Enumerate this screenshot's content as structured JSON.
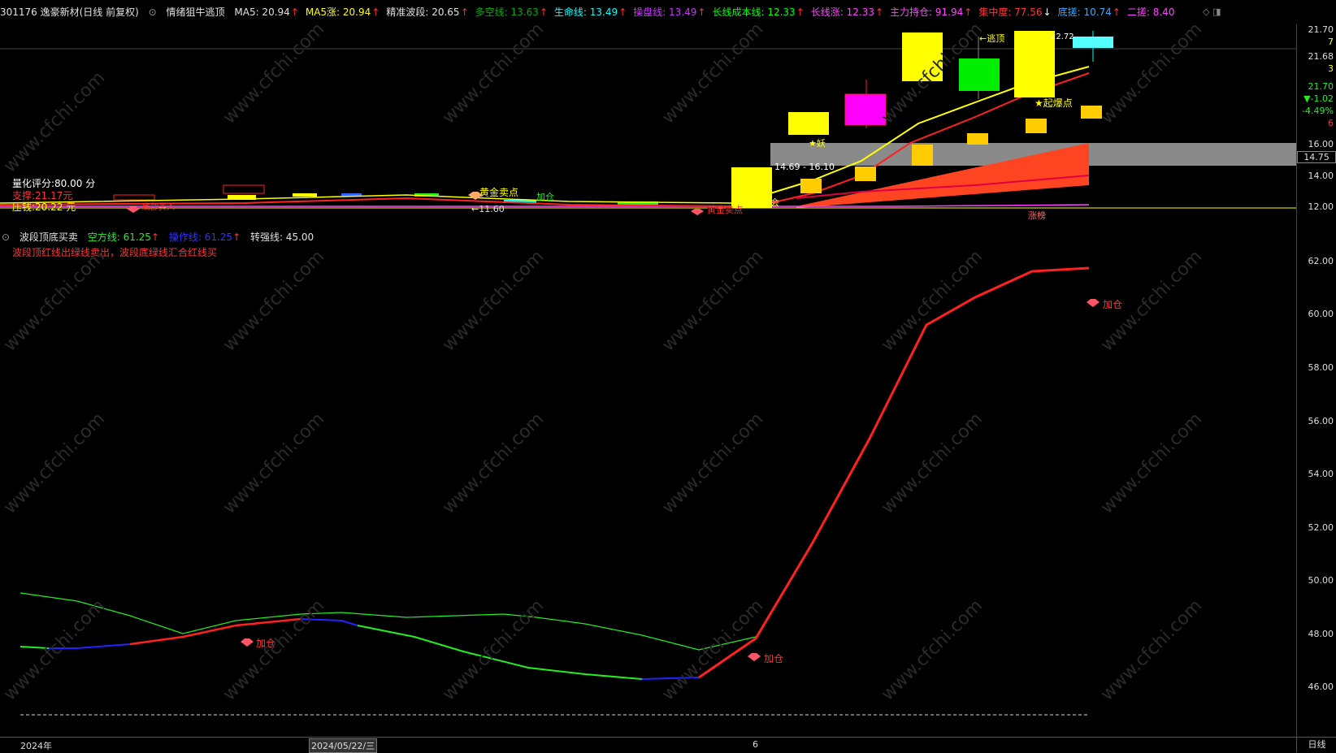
{
  "stock_header": {
    "code_name": "301176 逸豪新材(日线 前复权)",
    "indicator_name": "情绪狙牛逃顶",
    "items": [
      {
        "label": "MA5: 20.94",
        "color": "#e0e0e0",
        "arrow": "↑"
      },
      {
        "label": "MA5涨: 20.94",
        "color": "#ffff00",
        "arrow": "↑"
      },
      {
        "label": "精准波段: 20.65",
        "color": "#e0e0e0",
        "arrow": "↑"
      },
      {
        "label": "多空线: 13.63",
        "color": "#00aa00",
        "arrow": "↑"
      },
      {
        "label": "生命线: 13.49",
        "color": "#00ffff",
        "arrow": "↑"
      },
      {
        "label": "操盘线: 13.49",
        "color": "#cc33ff",
        "arrow": "↑"
      },
      {
        "label": "长线成本线: 12.33",
        "color": "#00ff00",
        "arrow": "↑"
      },
      {
        "label": "长线涨: 12.33",
        "color": "#ff44ff",
        "arrow": "↑"
      },
      {
        "label": "主力持仓: 91.94",
        "color": "#ff44ff",
        "arrow": "↑"
      },
      {
        "label": "集中度: 77.56",
        "color": "#ff3333",
        "arrow": "↓"
      },
      {
        "label": "底搓: 10.74",
        "color": "#33aaff",
        "arrow": "↑"
      },
      {
        "label": "二搓: 8.40",
        "color": "#ff44ff",
        "arrow": ""
      }
    ]
  },
  "price_panel": {
    "quant_score": "量化评分:80.00 分",
    "support": "支撑:21.17元",
    "pressure": "压钱:20.22 元",
    "range_label": "14.69 - 16.10",
    "low_mark": "←11.60",
    "high_mark": "←逃顶",
    "high_value": "22.72",
    "tags": {
      "gold_sell": "黄金卖点",
      "gold_sell2": "黄金卖点",
      "add_pos": "加仓",
      "rise_start": "★起爆点",
      "demon": "★妖",
      "limit_up": "涨榜",
      "bottom_buy": "底部买入",
      "main_hold": "揭竿机会"
    },
    "axis_labels": [
      "21.70",
      "21.68",
      "16.00",
      "14.00",
      "12.00"
    ],
    "axis_small": [
      "7",
      "3",
      "21.70",
      "▼-1.02",
      "-4.49%",
      "6"
    ],
    "axis_box": "14.75"
  },
  "osc_panel": {
    "title": "波段顶底买卖",
    "empty_line": "空方线: 61.25",
    "op_line": "操作线: 61.25",
    "strong_line": "转强线: 45.00",
    "note": "波段顶红线出绿线卖出，波段底绿线汇合红线买",
    "signal_label": "加仓",
    "axis_labels": [
      "62.00",
      "60.00",
      "58.00",
      "56.00",
      "54.00",
      "52.00",
      "50.00",
      "48.00",
      "46.00"
    ]
  },
  "bottom": {
    "year": "2024年",
    "date": "2024/05/22/三",
    "cursor": "6",
    "period": "日线"
  },
  "watermark": "www.cfchi.com",
  "colors": {
    "red_line": "#ff2020",
    "green_line": "#22ee22",
    "blue_line": "#2222ff",
    "yellow": "#ffff00",
    "magenta": "#ff00ff"
  }
}
